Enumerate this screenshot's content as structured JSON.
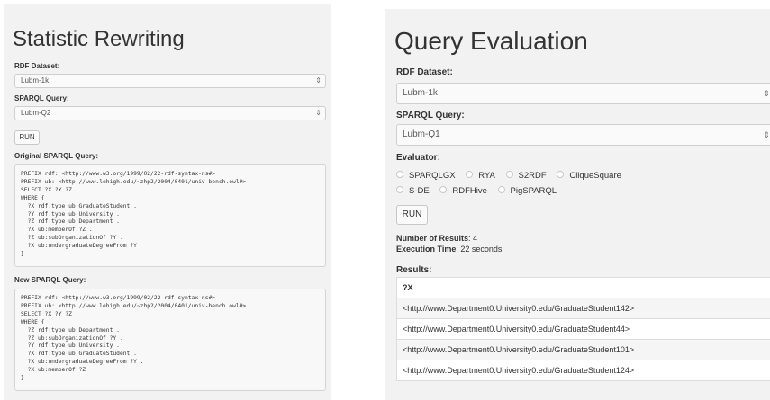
{
  "left": {
    "title": "Statistic Rewriting",
    "dataset_label": "RDF Dataset:",
    "dataset_value": "Lubm-1k",
    "query_label": "SPARQL Query:",
    "query_value": "Lubm-Q2",
    "run_label": "RUN",
    "original_label": "Original SPARQL Query:",
    "original_query": "PREFIX rdf: <http://www.w3.org/1999/02/22-rdf-syntax-ns#>\nPREFIX ub: <http://www.lehigh.edu/~zhp2/2004/0401/univ-bench.owl#>\nSELECT ?X ?Y ?Z\nWHERE {\n  ?X rdf:type ub:GraduateStudent .\n  ?Y rdf:type ub:University .\n  ?Z rdf:type ub:Department .\n  ?X ub:memberOf ?Z .\n  ?Z ub:subOrganizationOf ?Y .\n  ?X ub:undergraduateDegreeFrom ?Y\n}",
    "new_label": "New SPARQL Query:",
    "new_query": "PREFIX rdf: <http://www.w3.org/1999/02/22-rdf-syntax-ns#>\nPREFIX ub: <http://www.lehigh.edu/~zhp2/2004/0401/univ-bench.owl#>\nSELECT ?X ?Y ?Z\nWHERE {\n  ?Z rdf:type ub:Department .\n  ?Z ub:subOrganizationOf ?Y .\n  ?Y rdf:type ub:University .\n  ?X rdf:type ub:GraduateStudent .\n  ?X ub:undergraduateDegreeFrom ?Y .\n  ?X ub:memberOf ?Z\n}"
  },
  "right": {
    "title": "Query Evaluation",
    "dataset_label": "RDF Dataset:",
    "dataset_value": "Lubm-1k",
    "query_label": "SPARQL Query:",
    "query_value": "Lubm-Q1",
    "evaluator_label": "Evaluator:",
    "evaluators_row1": [
      "SPARQLGX",
      "RYA",
      "S2RDF",
      "CliqueSquare"
    ],
    "evaluators_row2": [
      "S-DE",
      "RDFHive",
      "PigSPARQL"
    ],
    "run_label": "RUN",
    "num_results_label": "Number of Results",
    "num_results_value": ": 4",
    "exec_time_label": "Execution Time",
    "exec_time_value": ": 22 seconds",
    "results_label": "Results:",
    "results_header": "?X",
    "results": [
      "<http://www.Department0.University0.edu/GraduateStudent142>",
      "<http://www.Department0.University0.edu/GraduateStudent44>",
      "<http://www.Department0.University0.edu/GraduateStudent101>",
      "<http://www.Department0.University0.edu/GraduateStudent124>"
    ]
  },
  "icons": {
    "select_arrow": "updown-chevron-icon"
  },
  "colors": {
    "panel_bg": "#f2f2f2",
    "code_bg": "#f8f8f8",
    "border": "#cfcfcf"
  }
}
